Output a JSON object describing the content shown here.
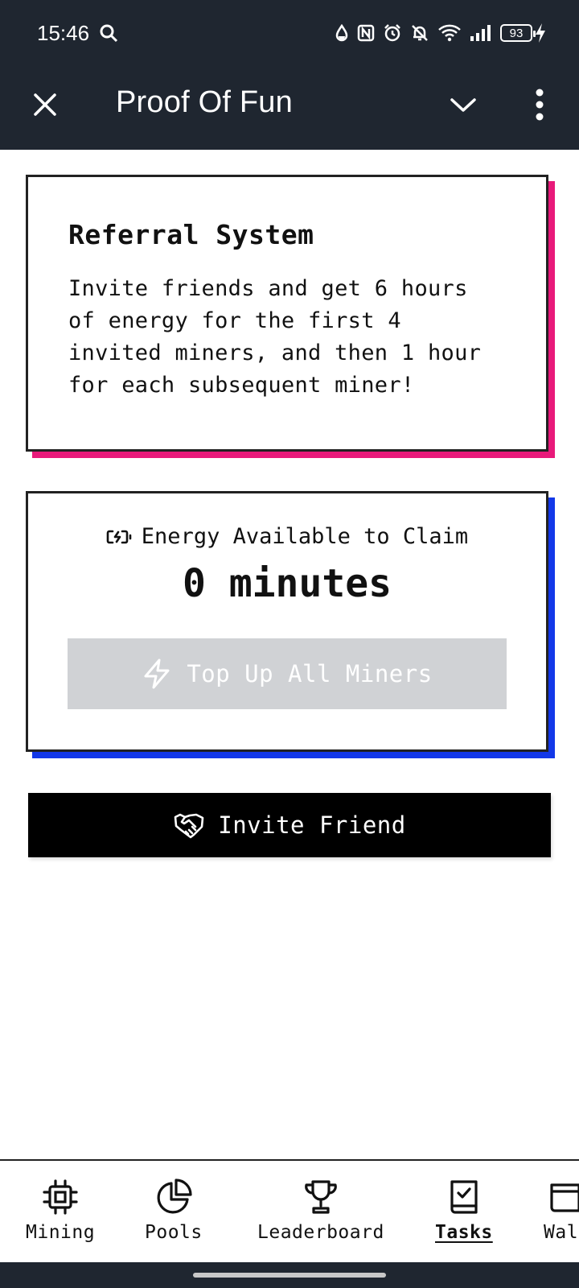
{
  "status_bar": {
    "time": "15:46",
    "battery": "93",
    "icons": [
      "search-icon",
      "drop-icon",
      "nfc-icon",
      "alarm-icon",
      "bell-off-icon",
      "wifi-icon",
      "signal-icon",
      "battery-icon",
      "charging-icon"
    ]
  },
  "appbar": {
    "title": "Proof Of Fun",
    "close_icon": "close-icon",
    "chevron_icon": "chevron-down-icon",
    "more_icon": "more-vertical-icon"
  },
  "referral": {
    "title": "Referral System",
    "body": "Invite friends and get 6 hours of energy for the first 4 invited miners, and then 1 hour for each subsequent miner!",
    "accent": "#e8197a"
  },
  "energy": {
    "label": "Energy Available to Claim",
    "value": "0 minutes",
    "button_label": "Top Up All Miners",
    "button_disabled": true,
    "accent": "#1338e8"
  },
  "invite": {
    "label": "Invite Friend",
    "icon": "handshake-icon"
  },
  "bottom_nav": {
    "items": [
      {
        "label": "Mining",
        "icon": "chip-icon",
        "active": false
      },
      {
        "label": "Pools",
        "icon": "pie-chart-icon",
        "active": false
      },
      {
        "label": "Leaderboard",
        "icon": "trophy-icon",
        "active": false
      },
      {
        "label": "Tasks",
        "icon": "task-list-icon",
        "active": true
      },
      {
        "label": "Wal",
        "icon": "wallet-icon",
        "active": false
      }
    ]
  },
  "colors": {
    "header_bg": "#1f2630",
    "pink_accent": "#e8197a",
    "blue_accent": "#1338e8",
    "disabled_button": "#d0d2d5"
  }
}
